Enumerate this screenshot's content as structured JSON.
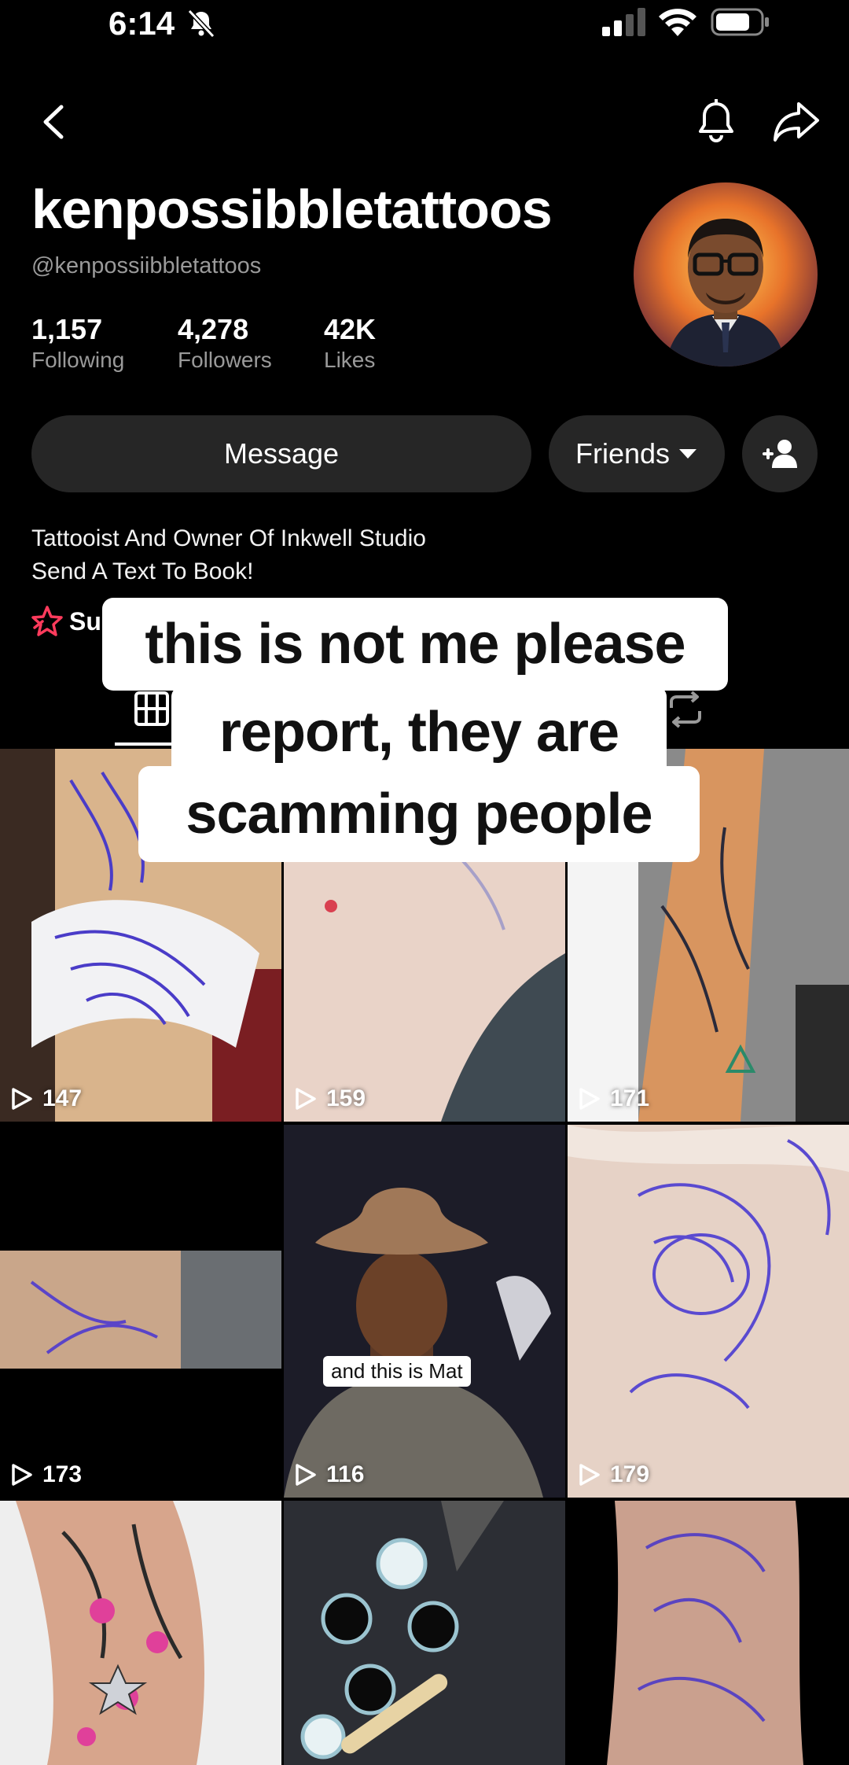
{
  "status_bar": {
    "time": "6:14"
  },
  "profile": {
    "display_name": "kenpossibbletattoos",
    "handle": "@kenpossiibbletattoos",
    "stats": [
      {
        "value": "1,157",
        "label": "Following"
      },
      {
        "value": "4,278",
        "label": "Followers"
      },
      {
        "value": "42K",
        "label": "Likes"
      }
    ],
    "bio_lines": [
      "Tattooist  And Owner Of Inkwell Studio",
      "Send A Text To Book!"
    ],
    "subscription_label": "Su"
  },
  "actions": {
    "message_label": "Message",
    "friends_label": "Friends"
  },
  "overlay_caption": {
    "lines": [
      "this is not me please",
      "report, they are",
      "scamming people"
    ]
  },
  "grid": {
    "videos": [
      {
        "views": "147"
      },
      {
        "views": "159"
      },
      {
        "views": "171"
      },
      {
        "views": "173"
      },
      {
        "views": "116",
        "caption": "and this is Mat"
      },
      {
        "views": "179"
      },
      {},
      {},
      {}
    ]
  },
  "colors": {
    "background": "#000000",
    "button": "#262626",
    "subscription_icon": "#ff3b5c"
  }
}
